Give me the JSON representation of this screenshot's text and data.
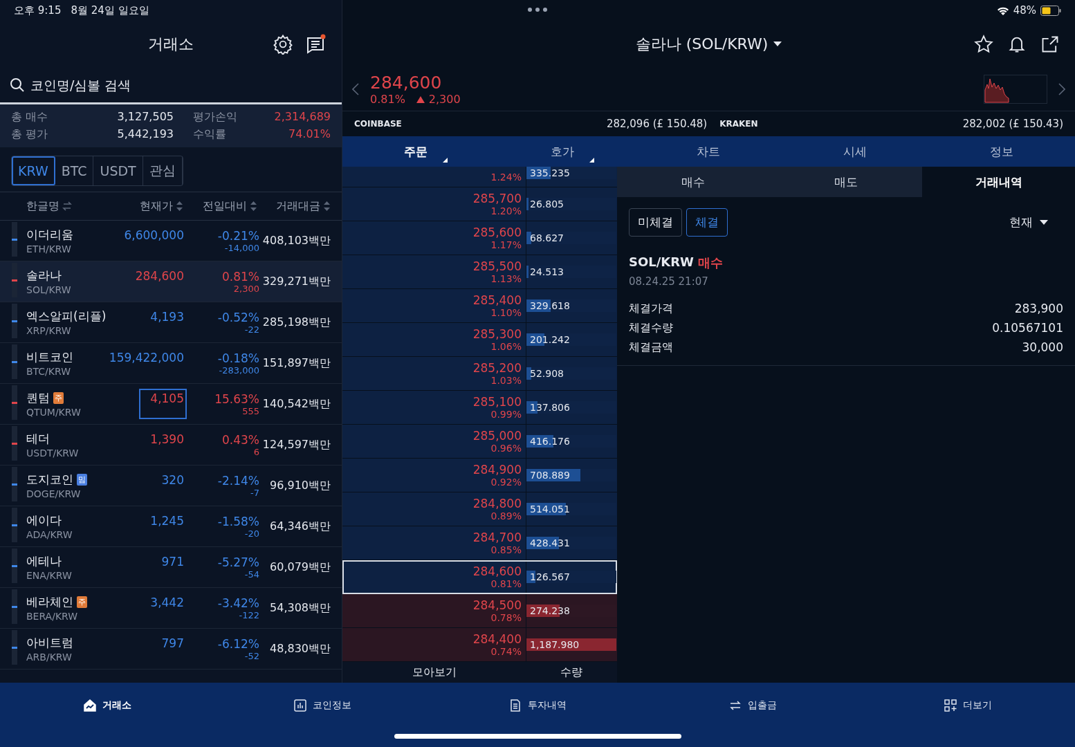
{
  "status_bar": {
    "time": "오후 9:15",
    "date": "8월 24일 일요일",
    "battery": "48%"
  },
  "market": {
    "title": "거래소",
    "search": {
      "placeholder": "코인명/심볼 검색"
    },
    "summary": [
      {
        "label": "총 매수",
        "value": "3,127,505",
        "kind": "flat"
      },
      {
        "label": "평가손익",
        "value": "2,314,689",
        "kind": "up"
      },
      {
        "label": "총 평가",
        "value": "5,442,193",
        "kind": "flat"
      },
      {
        "label": "수익률",
        "value": "74.01%",
        "kind": "up"
      }
    ],
    "currency_tabs": [
      {
        "label": "KRW",
        "selected": true
      },
      {
        "label": "BTC",
        "selected": false
      },
      {
        "label": "USDT",
        "selected": false
      },
      {
        "label": "관심",
        "selected": false
      }
    ],
    "columns": [
      {
        "label": "한글명",
        "kind": "swap"
      },
      {
        "label": "현재가",
        "kind": "sort"
      },
      {
        "label": "전일대비",
        "kind": "sort"
      },
      {
        "label": "거래대금",
        "kind": "sort"
      }
    ],
    "coins": [
      {
        "name": "이더리움",
        "symbol": "ETH/KRW",
        "price": "6,600,000",
        "change_pct": "-0.21%",
        "change_abs": "-14,000",
        "volume": "408,103백만",
        "kind": "down",
        "selected": false,
        "price_flash": false
      },
      {
        "name": "솔라나",
        "symbol": "SOL/KRW",
        "price": "284,600",
        "change_pct": "0.81%",
        "change_abs": "2,300",
        "volume": "329,271백만",
        "kind": "up",
        "selected": true,
        "price_flash": false
      },
      {
        "name": "엑스알피(리플)",
        "symbol": "XRP/KRW",
        "price": "4,193",
        "change_pct": "-0.52%",
        "change_abs": "-22",
        "volume": "285,198백만",
        "kind": "down",
        "selected": false,
        "price_flash": false
      },
      {
        "name": "비트코인",
        "symbol": "BTC/KRW",
        "price": "159,422,000",
        "change_pct": "-0.18%",
        "change_abs": "-283,000",
        "volume": "151,897백만",
        "kind": "down",
        "selected": false,
        "price_flash": false
      },
      {
        "name": "퀀텀",
        "badge": {
          "text": "주",
          "kind": "caution"
        },
        "symbol": "QTUM/KRW",
        "price": "4,105",
        "change_pct": "15.63%",
        "change_abs": "555",
        "volume": "140,542백만",
        "kind": "up",
        "selected": false,
        "price_flash": true
      },
      {
        "name": "테더",
        "symbol": "USDT/KRW",
        "price": "1,390",
        "change_pct": "0.43%",
        "change_abs": "6",
        "volume": "124,597백만",
        "kind": "up",
        "selected": false,
        "price_flash": false
      },
      {
        "name": "도지코인",
        "badge": {
          "text": "밈",
          "kind": "meme"
        },
        "symbol": "DOGE/KRW",
        "price": "320",
        "change_pct": "-2.14%",
        "change_abs": "-7",
        "volume": "96,910백만",
        "kind": "down",
        "selected": false,
        "price_flash": false
      },
      {
        "name": "에이다",
        "symbol": "ADA/KRW",
        "price": "1,245",
        "change_pct": "-1.58%",
        "change_abs": "-20",
        "volume": "64,346백만",
        "kind": "down",
        "selected": false,
        "price_flash": false
      },
      {
        "name": "에테나",
        "symbol": "ENA/KRW",
        "price": "971",
        "change_pct": "-5.27%",
        "change_abs": "-54",
        "volume": "60,079백만",
        "kind": "down",
        "selected": false,
        "price_flash": false
      },
      {
        "name": "베라체인",
        "badge": {
          "text": "주",
          "kind": "caution"
        },
        "symbol": "BERA/KRW",
        "price": "3,442",
        "change_pct": "-3.42%",
        "change_abs": "-122",
        "volume": "54,308백만",
        "kind": "down",
        "selected": false,
        "price_flash": false
      },
      {
        "name": "아비트럼",
        "symbol": "ARB/KRW",
        "price": "797",
        "change_pct": "-6.12%",
        "change_abs": "-52",
        "volume": "48,830백만",
        "kind": "down",
        "selected": false,
        "price_flash": false
      }
    ]
  },
  "detail": {
    "title": "솔라나 (SOL/KRW)",
    "price": "284,600",
    "change_pct": "0.81%",
    "change_abs": "2,300",
    "kind": "up",
    "exchanges": [
      {
        "name": "COINBASE",
        "value": "282,096 (£ 150.48)"
      },
      {
        "name": "KRAKEN",
        "value": "282,002 (£ 150.43)"
      }
    ],
    "tabs": [
      {
        "label": "주문",
        "selected": true,
        "kind": "menu"
      },
      {
        "label": "호가",
        "selected": false,
        "kind": "menu"
      },
      {
        "label": "차트",
        "selected": false,
        "kind": "plain"
      },
      {
        "label": "시세",
        "selected": false,
        "kind": "plain"
      },
      {
        "label": "정보",
        "selected": false,
        "kind": "plain"
      }
    ],
    "orderbook": [
      {
        "pct": "1.24%",
        "qty": "335.235",
        "level": 0.27,
        "kind": "ask",
        "selected": false
      },
      {
        "price": "285,700",
        "pct": "1.20%",
        "qty": "26.805",
        "level": 0.02,
        "kind": "ask",
        "selected": false
      },
      {
        "price": "285,600",
        "pct": "1.17%",
        "qty": "68.627",
        "level": 0.05,
        "kind": "ask",
        "selected": false
      },
      {
        "price": "285,500",
        "pct": "1.13%",
        "qty": "24.513",
        "level": 0.02,
        "kind": "ask",
        "selected": false
      },
      {
        "price": "285,400",
        "pct": "1.10%",
        "qty": "329.618",
        "level": 0.27,
        "kind": "ask",
        "selected": false
      },
      {
        "price": "285,300",
        "pct": "1.06%",
        "qty": "201.242",
        "level": 0.2,
        "kind": "ask",
        "selected": false
      },
      {
        "price": "285,200",
        "pct": "1.03%",
        "qty": "52.908",
        "level": 0.05,
        "kind": "ask",
        "selected": false
      },
      {
        "price": "285,100",
        "pct": "0.99%",
        "qty": "137.806",
        "level": 0.12,
        "kind": "ask",
        "selected": false
      },
      {
        "price": "285,000",
        "pct": "0.96%",
        "qty": "416.176",
        "level": 0.3,
        "kind": "ask",
        "selected": false
      },
      {
        "price": "284,900",
        "pct": "0.92%",
        "qty": "708.889",
        "level": 0.6,
        "kind": "ask",
        "selected": false
      },
      {
        "price": "284,800",
        "pct": "0.89%",
        "qty": "514.051",
        "level": 0.44,
        "kind": "ask",
        "selected": false
      },
      {
        "price": "284,700",
        "pct": "0.85%",
        "qty": "428.431",
        "level": 0.36,
        "kind": "ask",
        "selected": false
      },
      {
        "price": "284,600",
        "pct": "0.81%",
        "qty": "126.567",
        "level": 0.1,
        "kind": "ask",
        "selected": true
      },
      {
        "price": "284,500",
        "pct": "0.78%",
        "qty": "274.238",
        "level": 0.37,
        "kind": "bid",
        "selected": false
      },
      {
        "price": "284,400",
        "pct": "0.74%",
        "qty": "1,187.980",
        "level": 1.0,
        "kind": "bid",
        "selected": false
      }
    ],
    "orderbook_footer": [
      "모아보기",
      "수량"
    ],
    "order_tabs": [
      {
        "label": "매수",
        "selected": false
      },
      {
        "label": "매도",
        "selected": false
      },
      {
        "label": "거래내역",
        "selected": true
      }
    ],
    "filters": [
      {
        "label": "미체결",
        "selected": false
      },
      {
        "label": "체결",
        "selected": true
      }
    ],
    "period": "현재",
    "trade": {
      "pair": "SOL/KRW",
      "side": "매수",
      "time": "08.24.25 21:07",
      "fields": [
        {
          "label": "체결가격",
          "value": "283,900"
        },
        {
          "label": "체결수량",
          "value": "0.10567101"
        },
        {
          "label": "체결금액",
          "value": "30,000"
        }
      ]
    }
  },
  "nav": [
    {
      "label": "거래소",
      "kind": "exchange",
      "selected": true
    },
    {
      "label": "코인정보",
      "kind": "chart",
      "selected": false
    },
    {
      "label": "투자내역",
      "kind": "document",
      "selected": false
    },
    {
      "label": "입출금",
      "kind": "transfer",
      "selected": false
    },
    {
      "label": "더보기",
      "kind": "more",
      "selected": false
    }
  ]
}
